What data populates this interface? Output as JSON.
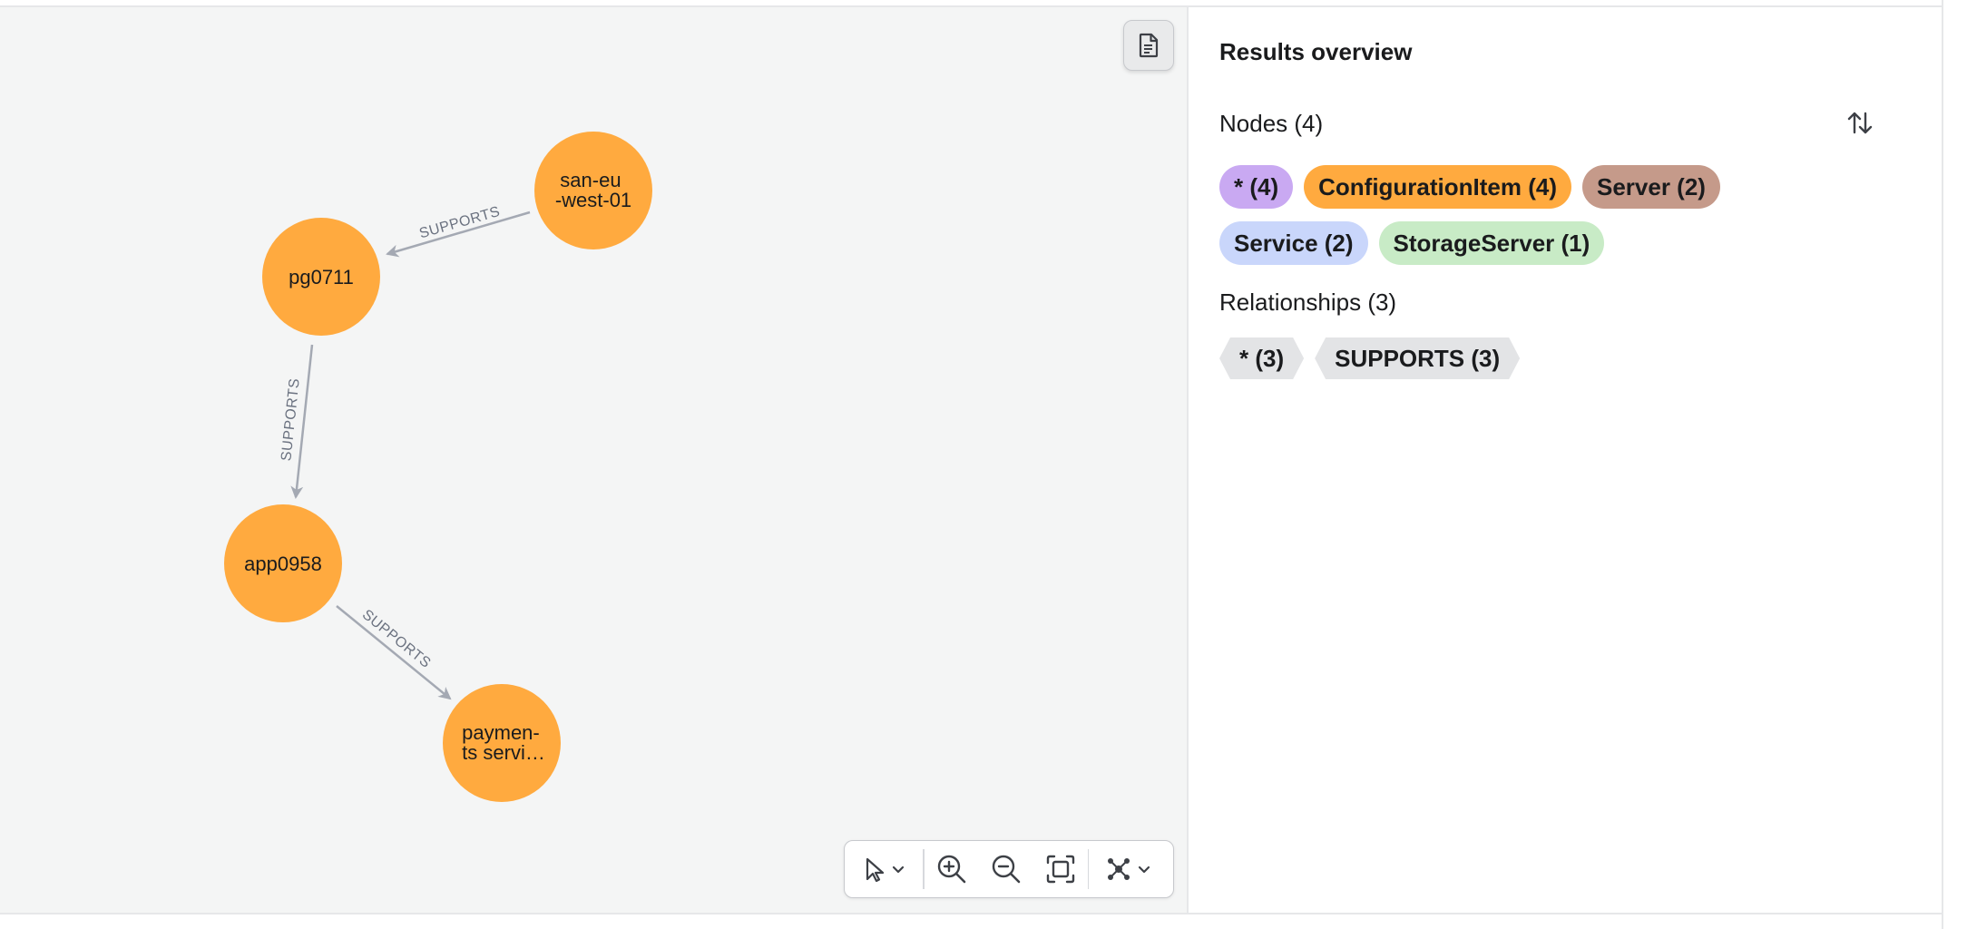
{
  "graph": {
    "nodes": [
      {
        "id": "san",
        "label_lines": [
          "san-eu",
          "-west-01"
        ]
      },
      {
        "id": "pg",
        "label_lines": [
          "pg0711"
        ]
      },
      {
        "id": "app",
        "label_lines": [
          "app0958"
        ]
      },
      {
        "id": "pay",
        "label_lines": [
          "paymen-",
          "ts servi…"
        ]
      }
    ],
    "edges": [
      {
        "from": "san",
        "to": "pg",
        "label": "SUPPORTS"
      },
      {
        "from": "pg",
        "to": "app",
        "label": "SUPPORTS"
      },
      {
        "from": "app",
        "to": "pay",
        "label": "SUPPORTS"
      }
    ],
    "node_color": "#ffaa3f",
    "edge_color": "#a4a9b3"
  },
  "toolbar": {
    "items": [
      "select-pointer-icon",
      "zoom-in-icon",
      "zoom-out-icon",
      "fit-to-screen-icon",
      "layout-graph-icon"
    ]
  },
  "panel": {
    "title": "Results overview",
    "nodes_label": "Nodes (4)",
    "node_chips": [
      {
        "label": "* (4)",
        "color": "#c9a9f2"
      },
      {
        "label": "ConfigurationItem (4)",
        "color": "#ffaa3f"
      },
      {
        "label": "Server (2)",
        "color": "#c59a8a"
      },
      {
        "label": "Service (2)",
        "color": "#c9d6fb"
      },
      {
        "label": "StorageServer (1)",
        "color": "#c8ebc6"
      }
    ],
    "relationships_label": "Relationships (3)",
    "relationship_chips": [
      {
        "label": "* (3)"
      },
      {
        "label": "SUPPORTS (3)"
      }
    ]
  }
}
